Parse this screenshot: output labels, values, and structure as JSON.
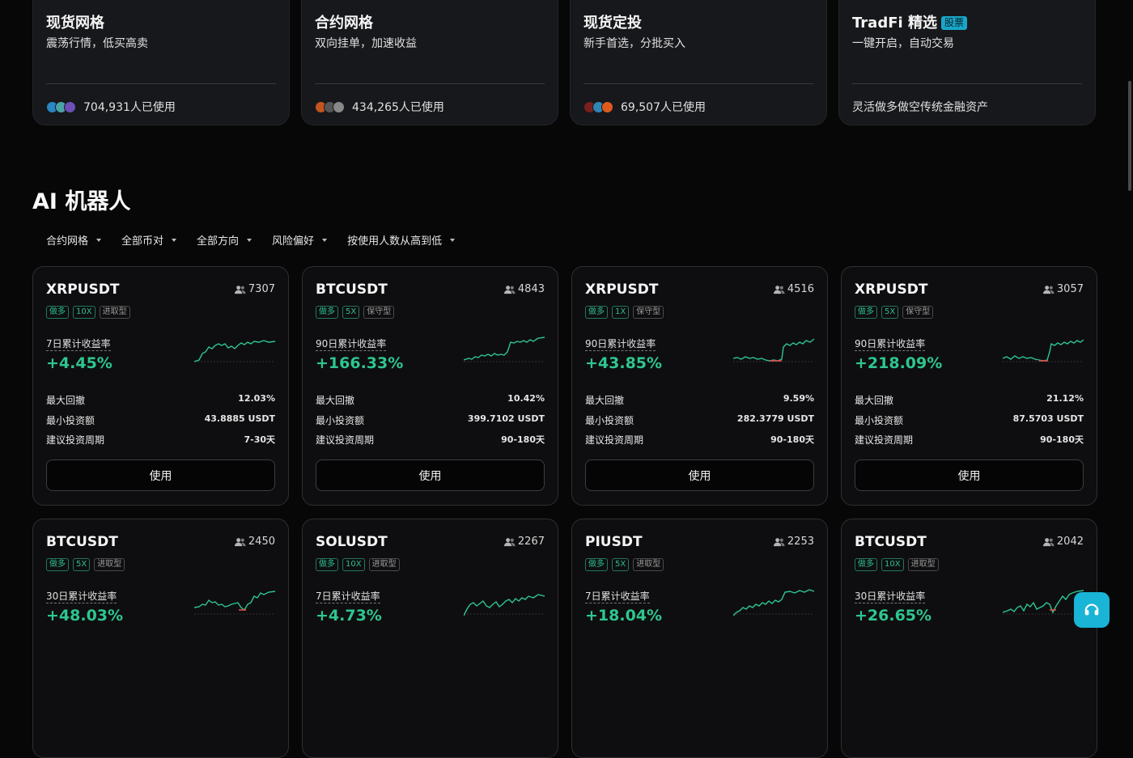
{
  "strategy_cards": [
    {
      "title": "现货网格",
      "badge": "",
      "subtitle": "震荡行情，低买高卖",
      "footer": "704,931人已使用",
      "avatars": [
        "#2a86c4",
        "#4aa3a6",
        "#6d4fb8"
      ]
    },
    {
      "title": "合约网格",
      "badge": "",
      "subtitle": "双向挂单，加速收益",
      "footer": "434,265人已使用",
      "avatars": [
        "#c2551f",
        "#555",
        "#888"
      ]
    },
    {
      "title": "现货定投",
      "badge": "",
      "subtitle": "新手首选，分批买入",
      "footer": "69,507人已使用",
      "avatars": [
        "#7a1f1f",
        "#2f86b3",
        "#e05a1f"
      ]
    },
    {
      "title": "TradFi 精选",
      "badge": "股票",
      "subtitle": "一键开启，自动交易",
      "footer": "灵活做多做空传统金融资产",
      "avatars": []
    }
  ],
  "section": {
    "title": "AI 机器人"
  },
  "filters": [
    "合约网格",
    "全部币对",
    "全部方向",
    "风险偏好",
    "按使用人数从高到低"
  ],
  "labels": {
    "max_drawdown": "最大回撤",
    "min_invest": "最小投资额",
    "period": "建议投资周期",
    "use": "使用"
  },
  "bots": [
    {
      "pair": "XRPUSDT",
      "users": "7307",
      "tags": [
        "做多",
        "10X",
        "进取型"
      ],
      "period_label": "7日累计收益率",
      "rate": "+4.45%",
      "max_drawdown": "12.03%",
      "min_invest": "43.8885 USDT",
      "period": "7-30天"
    },
    {
      "pair": "BTCUSDT",
      "users": "4843",
      "tags": [
        "做多",
        "5X",
        "保守型"
      ],
      "period_label": "90日累计收益率",
      "rate": "+166.33%",
      "max_drawdown": "10.42%",
      "min_invest": "399.7102 USDT",
      "period": "90-180天"
    },
    {
      "pair": "XRPUSDT",
      "users": "4516",
      "tags": [
        "做多",
        "1X",
        "保守型"
      ],
      "period_label": "90日累计收益率",
      "rate": "+43.85%",
      "max_drawdown": "9.59%",
      "min_invest": "282.3779 USDT",
      "period": "90-180天"
    },
    {
      "pair": "XRPUSDT",
      "users": "3057",
      "tags": [
        "做多",
        "5X",
        "保守型"
      ],
      "period_label": "90日累计收益率",
      "rate": "+218.09%",
      "max_drawdown": "21.12%",
      "min_invest": "87.5703 USDT",
      "period": "90-180天"
    },
    {
      "pair": "BTCUSDT",
      "users": "2450",
      "tags": [
        "做多",
        "5X",
        "进取型"
      ],
      "period_label": "30日累计收益率",
      "rate": "+48.03%",
      "max_drawdown": "",
      "min_invest": "",
      "period": ""
    },
    {
      "pair": "SOLUSDT",
      "users": "2267",
      "tags": [
        "做多",
        "10X",
        "进取型"
      ],
      "period_label": "7日累计收益率",
      "rate": "+4.73%",
      "max_drawdown": "",
      "min_invest": "",
      "period": ""
    },
    {
      "pair": "PIUSDT",
      "users": "2253",
      "tags": [
        "做多",
        "5X",
        "进取型"
      ],
      "period_label": "7日累计收益率",
      "rate": "+18.04%",
      "max_drawdown": "",
      "min_invest": "",
      "period": ""
    },
    {
      "pair": "BTCUSDT",
      "users": "2042",
      "tags": [
        "做多",
        "10X",
        "进取型"
      ],
      "period_label": "30日累计收益率",
      "rate": "+26.65%",
      "max_drawdown": "",
      "min_invest": "",
      "period": ""
    }
  ],
  "colors": {
    "positive": "#2ec68f",
    "negative": "#e54d4d",
    "accent": "#19b4d6"
  },
  "icons": {
    "users": "users-icon",
    "caret": "caret-down-icon",
    "support": "headset-icon"
  }
}
